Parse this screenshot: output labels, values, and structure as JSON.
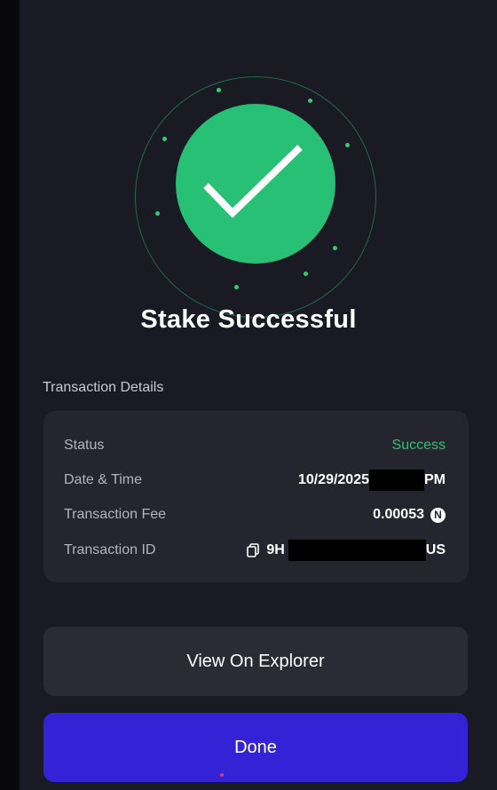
{
  "status_screen": {
    "title": "Stake Successful",
    "badge_icon": "checkmark-icon",
    "badge_color": "#27c074"
  },
  "details": {
    "section_label": "Transaction Details",
    "rows": [
      {
        "label": "Status",
        "value": "Success",
        "value_color": "#2bc56d"
      },
      {
        "label": "Date & Time",
        "value_prefix": "10/29/2025",
        "value_suffix": "PM",
        "redacted": true
      },
      {
        "label": "Transaction Fee",
        "value": "0.00053",
        "icon": "token-n-icon",
        "icon_glyph": "N"
      },
      {
        "label": "Transaction ID",
        "value_prefix": "9H",
        "value_suffix": "US",
        "icon": "copy-icon",
        "redacted": true
      }
    ]
  },
  "actions": {
    "explorer_label": "View On Explorer",
    "done_label": "Done",
    "primary_color": "#3423d6"
  }
}
